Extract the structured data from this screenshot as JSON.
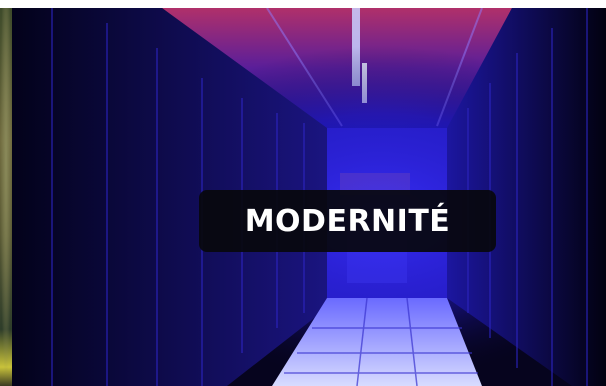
{
  "carousel": {
    "caption": "MODERNITÉ"
  },
  "colors": {
    "caption_background": "#08080c",
    "caption_text": "#ffffff",
    "image_tint": "#2a1fd6"
  }
}
